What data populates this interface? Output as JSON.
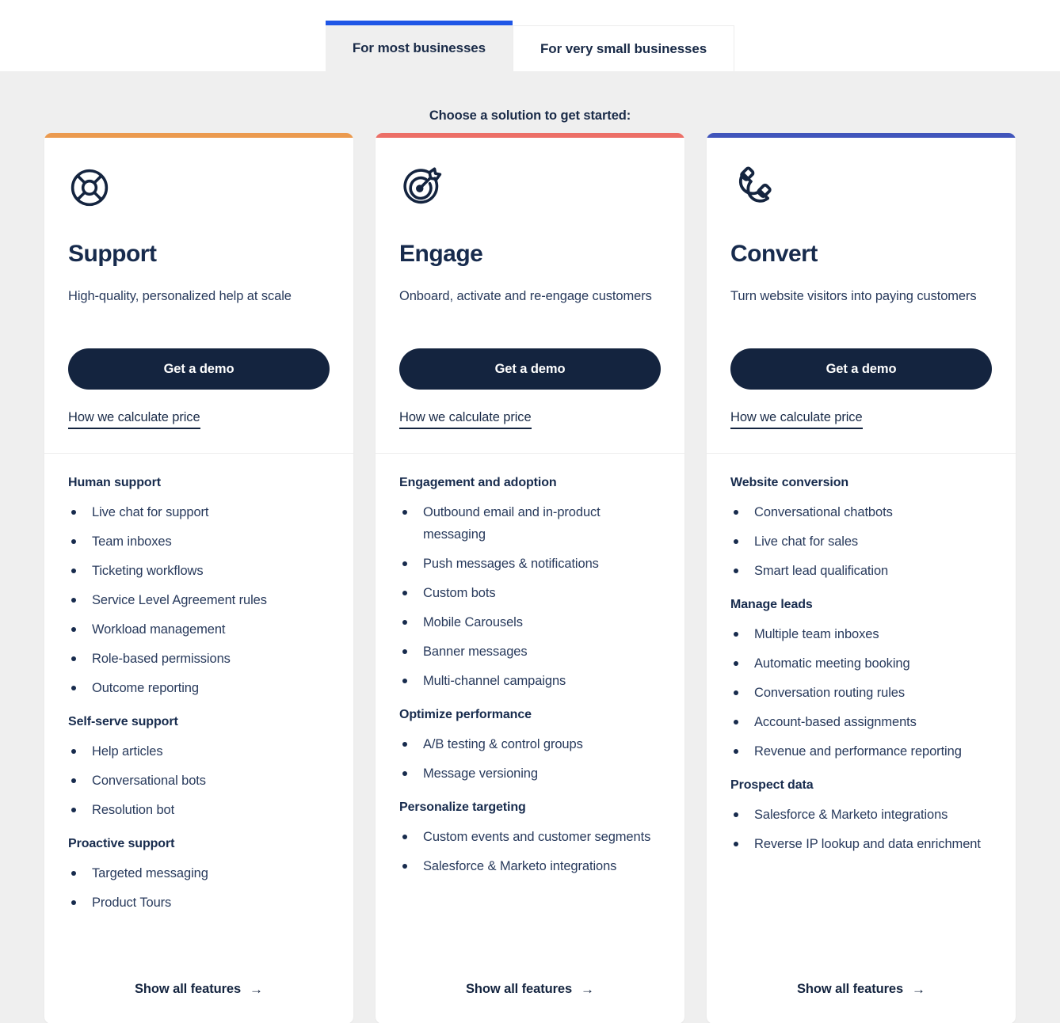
{
  "tabs": [
    {
      "label": "For most businesses",
      "active": true
    },
    {
      "label": "For very small businesses",
      "active": false
    }
  ],
  "heading": "Choose a solution to get started:",
  "common": {
    "demo_label": "Get a demo",
    "calc_label": "How we calculate price",
    "show_all_label": "Show all features",
    "arrow_glyph": "→"
  },
  "accent_colors": {
    "support": "#eb9a4f",
    "engage": "#ec6f67",
    "convert": "#4155bb",
    "tab_active_bar": "#1f56e6",
    "button": "#14243f",
    "text": "#172b4d",
    "page_bg": "#efefef"
  },
  "cards": [
    {
      "id": "support",
      "icon": "lifebuoy-icon",
      "accent": "#eb9a4f",
      "title": "Support",
      "description": "High-quality, personalized help at scale",
      "groups": [
        {
          "title": "Human support",
          "items": [
            "Live chat for support",
            "Team inboxes",
            "Ticketing workflows",
            "Service Level Agreement rules",
            "Workload management",
            "Role-based permissions",
            "Outcome reporting"
          ]
        },
        {
          "title": "Self-serve support",
          "items": [
            "Help articles",
            "Conversational bots",
            "Resolution bot"
          ]
        },
        {
          "title": "Proactive support",
          "items": [
            "Targeted messaging",
            "Product Tours"
          ]
        }
      ]
    },
    {
      "id": "engage",
      "icon": "target-dart-icon",
      "accent": "#ec6f67",
      "title": "Engage",
      "description": "Onboard, activate and re-engage customers",
      "groups": [
        {
          "title": "Engagement and adoption",
          "items": [
            "Outbound email and in-product messaging",
            "Push messages & notifications",
            "Custom bots",
            "Mobile Carousels",
            "Banner messages",
            "Multi-channel campaigns"
          ]
        },
        {
          "title": "Optimize performance",
          "items": [
            "A/B testing & control groups",
            "Message versioning"
          ]
        },
        {
          "title": "Personalize targeting",
          "items": [
            "Custom events and customer segments",
            "Salesforce & Marketo integrations"
          ]
        }
      ]
    },
    {
      "id": "convert",
      "icon": "magnet-icon",
      "accent": "#4155bb",
      "title": "Convert",
      "description": "Turn website visitors into paying customers",
      "groups": [
        {
          "title": "Website conversion",
          "items": [
            "Conversational chatbots",
            "Live chat for sales",
            "Smart lead qualification"
          ]
        },
        {
          "title": "Manage leads",
          "items": [
            "Multiple team inboxes",
            "Automatic meeting booking",
            "Conversation routing rules",
            "Account-based assignments",
            "Revenue and performance reporting"
          ]
        },
        {
          "title": "Prospect data",
          "items": [
            "Salesforce & Marketo integrations",
            "Reverse IP lookup and data enrichment"
          ]
        }
      ]
    }
  ]
}
